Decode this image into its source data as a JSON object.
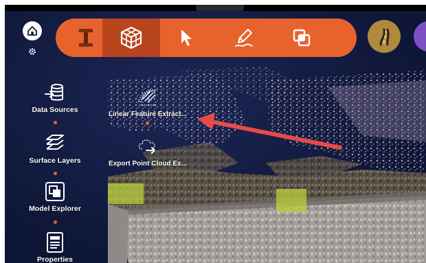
{
  "toolbar": {
    "tools": [
      {
        "name": "survey-tool",
        "icon": "steel-beam-icon"
      },
      {
        "name": "point-cloud-tool",
        "icon": "point-cloud-cube-icon",
        "selected": true
      },
      {
        "name": "select-tool",
        "icon": "cursor-arrow-icon"
      },
      {
        "name": "sketch-tool",
        "icon": "pencil-icon"
      },
      {
        "name": "layers-tool",
        "icon": "overlap-squares-icon"
      }
    ],
    "accent": "#e8622e",
    "selected_color": "#b8451e"
  },
  "side_panel": {
    "items": [
      {
        "label": "Data Sources",
        "icon": "database-import-icon"
      },
      {
        "label": "Surface Layers",
        "icon": "stacked-layers-icon"
      },
      {
        "label": "Model Explorer",
        "icon": "model-explorer-icon"
      },
      {
        "label": "Properties",
        "icon": "properties-sheet-icon"
      }
    ]
  },
  "point_cloud_menu": {
    "items": [
      {
        "label": "Linear Feature Extract...",
        "icon": "linear-feature-icon"
      },
      {
        "label": "Export Point Cloud Ex...",
        "icon": "export-point-cloud-icon"
      }
    ]
  },
  "colors": {
    "background": "#10183b",
    "road_button": "#b08a3c",
    "profile": "#7d4fc4",
    "annotation_arrow": "#e84a4a"
  }
}
